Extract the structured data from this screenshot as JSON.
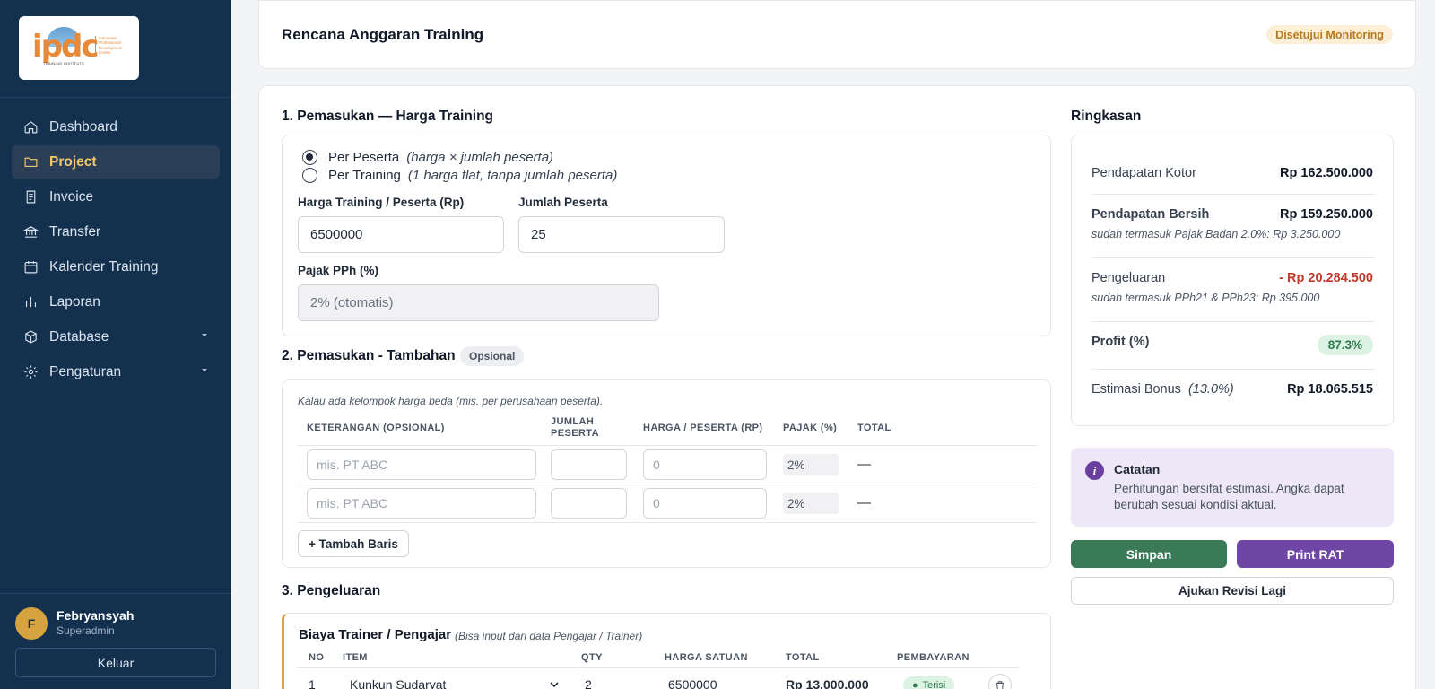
{
  "sidebar": {
    "logo": {
      "text": "ipdc",
      "subtitle": "Indonesia Professional Development Center",
      "tagline": "TRAINING INSTITUTE"
    },
    "nav": [
      {
        "label": "Dashboard",
        "icon": "home-icon"
      },
      {
        "label": "Project",
        "icon": "folder-icon",
        "active": true
      },
      {
        "label": "Invoice",
        "icon": "document-icon"
      },
      {
        "label": "Transfer",
        "icon": "bank-icon"
      },
      {
        "label": "Kalender Training",
        "icon": "calendar-icon"
      },
      {
        "label": "Laporan",
        "icon": "bar-chart-icon"
      },
      {
        "label": "Database",
        "icon": "box-icon",
        "has_submenu": true
      },
      {
        "label": "Pengaturan",
        "icon": "gear-icon",
        "has_submenu": true
      }
    ],
    "user": {
      "initial": "F",
      "name": "Febryansyah",
      "role": "Superadmin"
    },
    "logout_label": "Keluar"
  },
  "header": {
    "title": "Rencana Anggaran Training",
    "status": "Disetujui Monitoring"
  },
  "section1": {
    "title": "1. Pemasukan — Harga Training",
    "options": [
      {
        "label": "Per Peserta",
        "note": "(harga × jumlah peserta)",
        "selected": true
      },
      {
        "label": "Per Training",
        "note": "(1 harga flat, tanpa jumlah peserta)",
        "selected": false
      }
    ],
    "price_label": "Harga Training / Peserta (Rp)",
    "price_value": "6500000",
    "participants_label": "Jumlah Peserta",
    "participants_value": "25",
    "tax_label": "Pajak PPh (%)",
    "tax_value": "2% (otomatis)"
  },
  "section2": {
    "title": "2. Pemasukan - Tambahan",
    "badge": "Opsional",
    "hint": "Kalau ada kelompok harga beda (mis. per perusahaan peserta).",
    "columns": [
      "KETERANGAN (OPSIONAL)",
      "JUMLAH PESERTA",
      "HARGA / PESERTA (RP)",
      "PAJAK (%)",
      "TOTAL"
    ],
    "rows": [
      {
        "desc_placeholder": "mis. PT ABC",
        "qty": "",
        "price_placeholder": "0",
        "tax": "2%",
        "total": "—"
      },
      {
        "desc_placeholder": "mis. PT ABC",
        "qty": "",
        "price_placeholder": "0",
        "tax": "2%",
        "total": "—"
      }
    ],
    "add_row_label": "+ Tambah Baris"
  },
  "section3": {
    "title": "3. Pengeluaran",
    "trainer": {
      "title": "Biaya Trainer / Pengajar",
      "note": "(Bisa input dari data Pengajar / Trainer)",
      "columns": [
        "NO",
        "ITEM",
        "QTY",
        "HARGA SATUAN",
        "TOTAL",
        "PEMBAYARAN"
      ],
      "rows": [
        {
          "no": "1",
          "item": "Kunkun Sudaryat",
          "qty": "2",
          "unit_price": "6500000",
          "total": "Rp 13.000.000",
          "payment": "Terisi"
        }
      ]
    }
  },
  "summary": {
    "title": "Ringkasan",
    "gross_label": "Pendapatan Kotor",
    "gross_value": "Rp 162.500.000",
    "net_label": "Pendapatan Bersih",
    "net_value": "Rp 159.250.000",
    "net_note": "sudah termasuk Pajak Badan 2.0%: Rp 3.250.000",
    "expense_label": "Pengeluaran",
    "expense_value": "- Rp 20.284.500",
    "expense_note": "sudah termasuk PPh21 & PPh23: Rp 395.000",
    "profit_label": "Profit (%)",
    "profit_value": "87.3%",
    "bonus_label": "Estimasi Bonus",
    "bonus_rate": "(13.0%)",
    "bonus_value": "Rp 18.065.515"
  },
  "note": {
    "title": "Catatan",
    "text": "Perhitungan bersifat estimasi. Angka dapat berubah sesuai kondisi aktual."
  },
  "actions": {
    "save_label": "Simpan",
    "print_label": "Print RAT",
    "revise_label": "Ajukan Revisi Lagi"
  },
  "colors": {
    "sidebar_bg": "#13304f",
    "active_nav": "#f4c86a",
    "save_btn": "#3a7a57",
    "print_btn": "#6f46a6",
    "expense_red": "#c0392b",
    "accent_gold": "#d7a340"
  }
}
